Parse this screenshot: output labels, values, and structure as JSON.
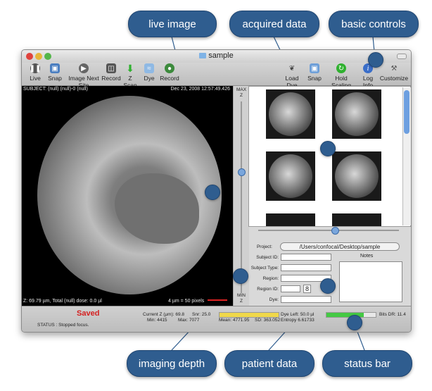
{
  "callouts": {
    "live_image": "live image",
    "acquired_data": "acquired data",
    "basic_controls": "basic controls",
    "imaging_depth": "imaging depth",
    "patient_data": "patient data",
    "status_bar": "status bar"
  },
  "window": {
    "title": "sample",
    "toolbar_left": [
      {
        "label": "Live",
        "icon": "pause-icon"
      },
      {
        "label": "Snap",
        "icon": "camera-icon"
      },
      {
        "label": "Image Next Site",
        "icon": "next-site-icon"
      },
      {
        "label": "Record",
        "icon": "record-icon"
      },
      {
        "label": "Z Scan",
        "icon": "down-arrow-icon"
      },
      {
        "label": "Dye",
        "icon": "dye-icon"
      },
      {
        "label": "Record",
        "icon": "globe-icon"
      }
    ],
    "toolbar_right": [
      {
        "label": "Load Dye",
        "icon": "pipette-icon"
      },
      {
        "label": "Snap",
        "icon": "image-icon"
      },
      {
        "label": "Hold Scaling",
        "icon": "scaling-icon"
      },
      {
        "label": "Log Info",
        "icon": "info-icon"
      },
      {
        "label": "Customize",
        "icon": "tools-icon"
      }
    ]
  },
  "viewer": {
    "subject_line": "SUBJECT: (null) (null)-0 (null)",
    "timestamp": "Dec 23, 2008 12:57:49.426",
    "depth_line": "Z: 69.79 µm, Total (null) dose:  0.0 µl",
    "scale_text": "4 µm = 50 pixels"
  },
  "zbar": {
    "max_label": "MAX",
    "max_z": "Z",
    "min_label": "MIN",
    "min_z": "Z"
  },
  "patient": {
    "project_label": "Project:",
    "project_path": "/Users/confocal/Desktop/sample",
    "subject_id_label": "Subject ID:",
    "subject_type_label": "Subject Type:",
    "region_label": "Region:",
    "region_id_label": "Region ID:",
    "region_id_value": "8",
    "dye_label": "Dye:",
    "notes_label": "Notes"
  },
  "status": {
    "saved": "Saved",
    "status_text": "STATUS : Stopped focus.",
    "current_z": "Current Z (µm):  69.8",
    "min": "Min:   4415",
    "max": "Max:   7077",
    "snr": "Snr:   25.0",
    "mean": "Mean:  4771.95",
    "sd": "SD:   363.052",
    "dye_left": "Dye Left:   50.0 µl",
    "entropy": "Entropy   6.61733",
    "bits_dr": "Bits DR:   11.4"
  },
  "colors": {
    "callout_blue": "#2f5d8f",
    "saved_red": "#d42020",
    "dye_bar_green": "#44c944",
    "intensity_bar_yellow": "#f0d84a"
  },
  "dye_fill_fraction": 0.75
}
